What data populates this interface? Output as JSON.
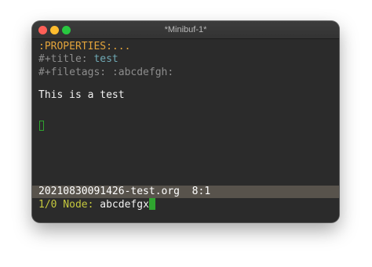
{
  "window": {
    "title": "*Minibuf-1*"
  },
  "colors": {
    "close": "#fe5f57",
    "minimize": "#febc2e",
    "zoom": "#28c840",
    "properties": "#e2a33b",
    "keyword": "#8d8d8d",
    "title_value": "#6fa9b5",
    "text": "#f2f2f2",
    "modeline_text": "#ffffff",
    "prompt": "#c5c83e",
    "cursor": "#2fa42f"
  },
  "buffer": {
    "properties_drawer": ":PROPERTIES:...",
    "title_keyword": "#+title: ",
    "title_value": "test",
    "filetags_line": "#+filetags: :abcdefgh:",
    "body_line": "This is a test"
  },
  "modeline": {
    "buffer_name": "20210830091426-test.org",
    "position": "8:1"
  },
  "minibuffer": {
    "prompt": "1/0 Node: ",
    "input": "abcdefgx"
  }
}
